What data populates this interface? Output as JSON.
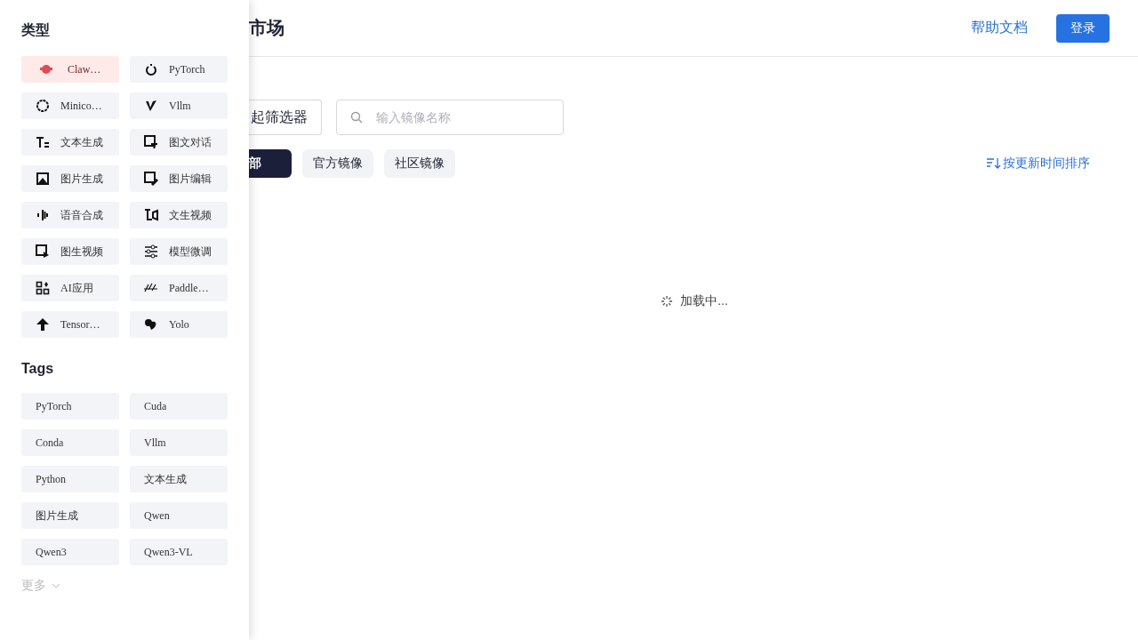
{
  "header": {
    "title": "市场",
    "help_link": "帮助文档",
    "login_button": "登录"
  },
  "toolbar": {
    "filter_button": "起筛选器",
    "search": {
      "placeholder": "输入镜像名称"
    }
  },
  "source_tabs": [
    {
      "label": "部",
      "selected": true
    },
    {
      "label": "官方镜像",
      "selected": false
    },
    {
      "label": "社区镜像",
      "selected": false
    }
  ],
  "sort_button": "按更新时间排序",
  "loading": "加载中...",
  "drawer": {
    "types_title": "类型",
    "types": [
      {
        "label": "Claw…",
        "selected": true
      },
      {
        "label": "PyTorch",
        "selected": false
      },
      {
        "label": "Minico…",
        "selected": false
      },
      {
        "label": "Vllm",
        "selected": false
      },
      {
        "label": "文本生成",
        "selected": false
      },
      {
        "label": "图文对话",
        "selected": false
      },
      {
        "label": "图片生成",
        "selected": false
      },
      {
        "label": "图片编辑",
        "selected": false
      },
      {
        "label": "语音合成",
        "selected": false
      },
      {
        "label": "文生视频",
        "selected": false
      },
      {
        "label": "图生视频",
        "selected": false
      },
      {
        "label": "模型微调",
        "selected": false
      },
      {
        "label": "AI应用",
        "selected": false
      },
      {
        "label": "Paddle…",
        "selected": false
      },
      {
        "label": "Tensor…",
        "selected": false
      },
      {
        "label": "Yolo",
        "selected": false
      }
    ],
    "tags_title": "Tags",
    "tags": [
      {
        "label": "PyTorch",
        "selected": false
      },
      {
        "label": "Cuda",
        "selected": false
      },
      {
        "label": "Conda",
        "selected": false
      },
      {
        "label": "Vllm",
        "selected": false
      },
      {
        "label": "Python",
        "selected": false
      },
      {
        "label": "文本生成",
        "selected": false
      },
      {
        "label": "图片生成",
        "selected": false
      },
      {
        "label": "Qwen",
        "selected": false
      },
      {
        "label": "Qwen3",
        "selected": false
      },
      {
        "label": "Qwen3-VL",
        "selected": false
      }
    ],
    "more_link": "更多"
  }
}
